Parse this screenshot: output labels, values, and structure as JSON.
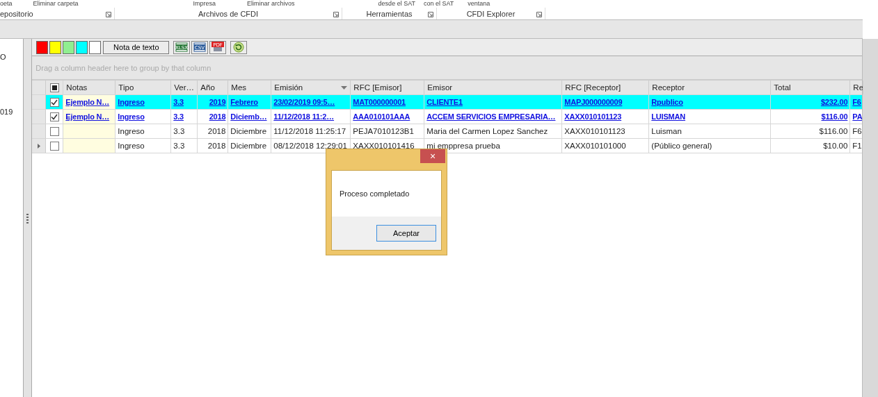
{
  "ribbon": {
    "top_items": [
      "oeta",
      "Eliminar carpeta",
      "Impresa",
      "Eliminar archivos",
      "desde el SAT",
      "con el SAT",
      "ventana"
    ],
    "groups": [
      {
        "label": "epositorio"
      },
      {
        "label": "Archivos de CFDI"
      },
      {
        "label": "Herramientas"
      },
      {
        "label": "CFDI Explorer"
      }
    ]
  },
  "side_panel": {
    "items": [
      "O",
      "019"
    ]
  },
  "toolbar": {
    "swatches": [
      {
        "color": "#ff0000"
      },
      {
        "color": "#ffff00"
      },
      {
        "color": "#90ee90"
      },
      {
        "color": "#00ffff"
      },
      {
        "color": "#ffffff"
      }
    ],
    "note_button": "Nota de texto",
    "export_buttons": [
      {
        "label": "XLSX"
      },
      {
        "label": "CSV"
      },
      {
        "label": "PDF"
      }
    ]
  },
  "grid": {
    "group_panel": "Drag a column header here to group by that column",
    "select_all": {
      "partial": true
    },
    "columns": [
      {
        "label": "Notas",
        "kind": "text"
      },
      {
        "label": "Tipo",
        "kind": "text"
      },
      {
        "label": "Ver…",
        "kind": "text"
      },
      {
        "label": "Año",
        "kind": "number"
      },
      {
        "label": "Mes",
        "kind": "text"
      },
      {
        "label": "Emisión",
        "kind": "text",
        "sorted": true
      },
      {
        "label": "RFC [Emisor]",
        "kind": "text"
      },
      {
        "label": "Emisor",
        "kind": "text"
      },
      {
        "label": "RFC [Receptor]",
        "kind": "text"
      },
      {
        "label": "Receptor",
        "kind": "text"
      },
      {
        "label": "Total",
        "kind": "number"
      },
      {
        "label": "Re",
        "kind": "text"
      }
    ],
    "rows": [
      {
        "checked": true,
        "link": true,
        "selected": false,
        "color": "#00ffff",
        "cells": [
          "Ejemplo N…",
          "Ingreso",
          "3.3",
          "2019",
          "Febrero",
          "23/02/2019 09:5…",
          "MAT000000001",
          "CLIENTE1",
          "MAPJ000000009",
          "Rpublico",
          "$232.00",
          "F6"
        ]
      },
      {
        "checked": true,
        "link": true,
        "selected": false,
        "color": "#ffffff",
        "cells": [
          "Ejemplo N…",
          "Ingreso",
          "3.3",
          "2018",
          "Diciemb…",
          "11/12/2018 11:2…",
          "AAA010101AAA",
          "ACCEM SERVICIOS EMPRESARIA…",
          "XAXX010101123",
          "LUISMAN",
          "$116.00",
          "PA"
        ]
      },
      {
        "checked": false,
        "link": false,
        "selected": false,
        "color": "#ffffff",
        "cells": [
          "",
          "Ingreso",
          "3.3",
          "2018",
          "Diciembre",
          "11/12/2018 11:25:17",
          "PEJA7010123B1",
          "Maria del Carmen Lopez Sanchez",
          "XAXX010101123",
          "Luisman",
          "$116.00",
          "F6"
        ]
      },
      {
        "checked": false,
        "link": false,
        "selected": true,
        "color": "#ffffff",
        "cells": [
          "",
          "Ingreso",
          "3.3",
          "2018",
          "Diciembre",
          "08/12/2018 12:29:01",
          "XAXX010101416",
          "mi emppresa prueba",
          "XAXX010101000",
          "(Público general)",
          "$10.00",
          "F1"
        ]
      }
    ]
  },
  "dialog": {
    "message": "Proceso completado",
    "button": "Aceptar",
    "close": "×"
  }
}
